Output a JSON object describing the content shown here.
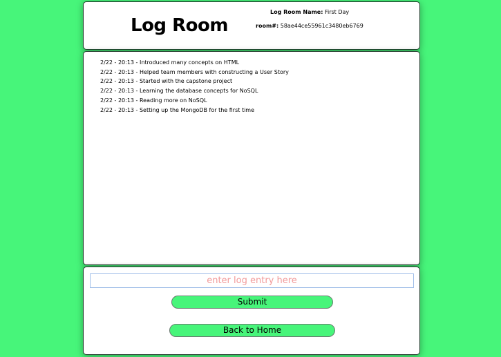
{
  "header": {
    "title": "Log Room",
    "room_name_label": "Log Room Name:",
    "room_name_value": "First Day",
    "room_id_label": "room#:",
    "room_id_value": "58ae44ce55961c3480eb6769"
  },
  "log": {
    "entries": [
      "2/22 - 20:13 - Introduced many concepts on HTML",
      "2/22 - 20:13 - Helped team members with constructing a User Story",
      "2/22 - 20:13 - Started with the capstone project",
      "2/22 - 20:13 - Learning the database concepts for NoSQL",
      "2/22 - 20:13 - Reading more on NoSQL",
      "2/22 - 20:13 - Setting up the MongoDB for the first time"
    ]
  },
  "form": {
    "input_value": "",
    "input_placeholder": "enter log entry here",
    "submit_label": "Submit",
    "home_label": "Back to Home"
  },
  "colors": {
    "background": "#47f57a",
    "button": "#47f57a",
    "placeholder": "#f29a9a"
  }
}
